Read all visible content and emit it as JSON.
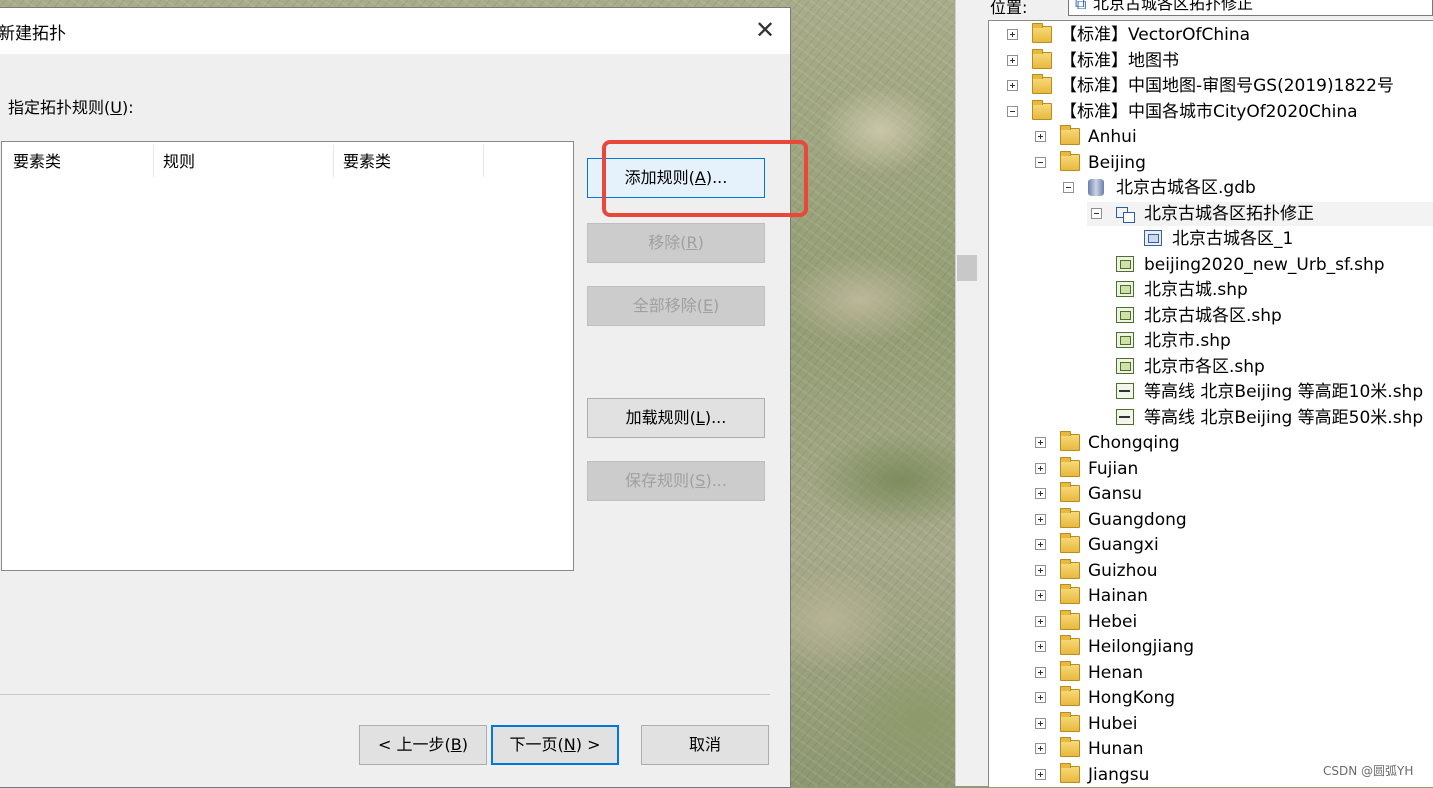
{
  "dialog": {
    "title": "新建拓扑",
    "close_glyph": "✕",
    "rule_label_prefix": "指定拓扑规则(",
    "rule_label_key": "U",
    "rule_label_suffix": "):",
    "columns": [
      "要素类",
      "规则",
      "要素类"
    ],
    "buttons": {
      "add_rule": {
        "prefix": "添加规则(",
        "key": "A",
        "suffix": ")..."
      },
      "remove": {
        "prefix": "移除(",
        "key": "R",
        "suffix": ")"
      },
      "remove_all": {
        "prefix": "全部移除(",
        "key": "E",
        "suffix": ")"
      },
      "load_rules": {
        "prefix": "加载规则(",
        "key": "L",
        "suffix": ")..."
      },
      "save_rules": {
        "prefix": "保存规则(",
        "key": "S",
        "suffix": ")..."
      },
      "back": {
        "prefix": "< 上一步(",
        "key": "B",
        "suffix": ")"
      },
      "next": {
        "prefix": "下一页(",
        "key": "N",
        "suffix": ") >"
      },
      "cancel": "取消"
    }
  },
  "catalog": {
    "location_label": "位置:",
    "location_value": "北京古城各区拓扑修正",
    "tree": [
      {
        "label": "【标准】VectorOfChina",
        "icon": "folder-icon",
        "expander": "plus"
      },
      {
        "label": "【标准】地图书",
        "icon": "folder-icon",
        "expander": "plus"
      },
      {
        "label": "【标准】中国地图-审图号GS(2019)1822号",
        "icon": "folder-icon",
        "expander": "plus"
      },
      {
        "label": "【标准】中国各城市CityOf2020China",
        "icon": "folder-icon",
        "expander": "minus"
      },
      {
        "label": "Anhui",
        "icon": "folder-icon",
        "expander": "plus"
      },
      {
        "label": "Beijing",
        "icon": "folder-icon",
        "expander": "minus"
      },
      {
        "label": "北京古城各区.gdb",
        "icon": "geodatabase-icon",
        "expander": "minus"
      },
      {
        "label": "北京古城各区拓扑修正",
        "icon": "topology-icon",
        "expander": "minus"
      },
      {
        "label": "北京古城各区_1",
        "icon": "polygon-feature-class-icon",
        "expander": "none"
      },
      {
        "label": "beijing2020_new_Urb_sf.shp",
        "icon": "polygon-shapefile-icon",
        "expander": "none"
      },
      {
        "label": "北京古城.shp",
        "icon": "polygon-shapefile-icon",
        "expander": "none"
      },
      {
        "label": "北京古城各区.shp",
        "icon": "polygon-shapefile-icon",
        "expander": "none"
      },
      {
        "label": "北京市.shp",
        "icon": "polygon-shapefile-icon",
        "expander": "none"
      },
      {
        "label": "北京市各区.shp",
        "icon": "polygon-shapefile-icon",
        "expander": "none"
      },
      {
        "label": "等高线 北京Beijing 等高距10米.shp",
        "icon": "line-shapefile-icon",
        "expander": "none"
      },
      {
        "label": "等高线 北京Beijing 等高距50米.shp",
        "icon": "line-shapefile-icon",
        "expander": "none"
      },
      {
        "label": "Chongqing",
        "icon": "folder-icon",
        "expander": "plus"
      },
      {
        "label": "Fujian",
        "icon": "folder-icon",
        "expander": "plus"
      },
      {
        "label": "Gansu",
        "icon": "folder-icon",
        "expander": "plus"
      },
      {
        "label": "Guangdong",
        "icon": "folder-icon",
        "expander": "plus"
      },
      {
        "label": "Guangxi",
        "icon": "folder-icon",
        "expander": "plus"
      },
      {
        "label": "Guizhou",
        "icon": "folder-icon",
        "expander": "plus"
      },
      {
        "label": "Hainan",
        "icon": "folder-icon",
        "expander": "plus"
      },
      {
        "label": "Hebei",
        "icon": "folder-icon",
        "expander": "plus"
      },
      {
        "label": "Heilongjiang",
        "icon": "folder-icon",
        "expander": "plus"
      },
      {
        "label": "Henan",
        "icon": "folder-icon",
        "expander": "plus"
      },
      {
        "label": "HongKong",
        "icon": "folder-icon",
        "expander": "plus"
      },
      {
        "label": "Hubei",
        "icon": "folder-icon",
        "expander": "plus"
      },
      {
        "label": "Hunan",
        "icon": "folder-icon",
        "expander": "plus"
      },
      {
        "label": "Jiangsu",
        "icon": "folder-icon",
        "expander": "plus"
      }
    ]
  },
  "watermark": "CSDN @圆弧YH",
  "colors": {
    "highlight": "#e8473a",
    "focus": "#0078d7"
  }
}
